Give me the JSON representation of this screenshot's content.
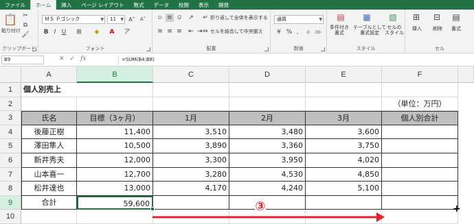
{
  "ribbon": {
    "tabs": [
      "ファイル",
      "ホーム",
      "挿入",
      "ページ レイアウト",
      "数式",
      "データ",
      "校閲",
      "表示",
      "開発"
    ],
    "clipboard": {
      "paste_label": "貼り付け",
      "group_label": "クリップボード"
    },
    "font": {
      "name": "ＭＳ Ｐゴシック",
      "size": "11",
      "group_label": "フォント"
    },
    "alignment": {
      "wrap_label": "折り返して全体を表示する",
      "merge_label": "セルを結合して中央揃え",
      "group_label": "配置"
    },
    "number": {
      "format": "通貨",
      "group_label": "数値"
    },
    "styles": {
      "conditional_label": "条件付き\n書式",
      "table_label": "テーブルとして\n書式設定",
      "cell_style_label": "セルの\nスタイル",
      "group_label": "スタイル"
    },
    "cells": {
      "insert_label": "挿入",
      "delete_label": "削除",
      "format_label": "書式",
      "group_label": "セル"
    }
  },
  "formula_bar": {
    "name_box": "B9",
    "formula": "=SUM(B4:B8)",
    "fx": "fx"
  },
  "columns": [
    "A",
    "B",
    "C",
    "D",
    "E",
    "F"
  ],
  "rows": [
    "1",
    "2",
    "3",
    "4",
    "5",
    "6",
    "7",
    "8",
    "9",
    "10"
  ],
  "sheet": {
    "title": "個人別売上",
    "unit": "（単位：万円）",
    "headers": [
      "氏名",
      "目標（3ヶ月）",
      "1月",
      "2月",
      "3月",
      "個人別合計"
    ],
    "data": [
      [
        "後藤正樹",
        "11,400",
        "3,510",
        "3,480",
        "3,600",
        ""
      ],
      [
        "澤田隼人",
        "10,500",
        "3,890",
        "3,360",
        "3,750",
        ""
      ],
      [
        "新井秀夫",
        "12,000",
        "3,300",
        "3,950",
        "4,020",
        ""
      ],
      [
        "山本喜一",
        "12,700",
        "3,280",
        "4,530",
        "4,850",
        ""
      ],
      [
        "松井達也",
        "13,000",
        "4,170",
        "4,240",
        "5,100",
        ""
      ]
    ],
    "total": [
      "合計",
      "59,600",
      "",
      "",
      "",
      ""
    ]
  },
  "annotation": {
    "marker": "③",
    "color": "#e8202a"
  },
  "colors": {
    "excel_green": "#217346",
    "header_fill": "#bfbfbf"
  }
}
